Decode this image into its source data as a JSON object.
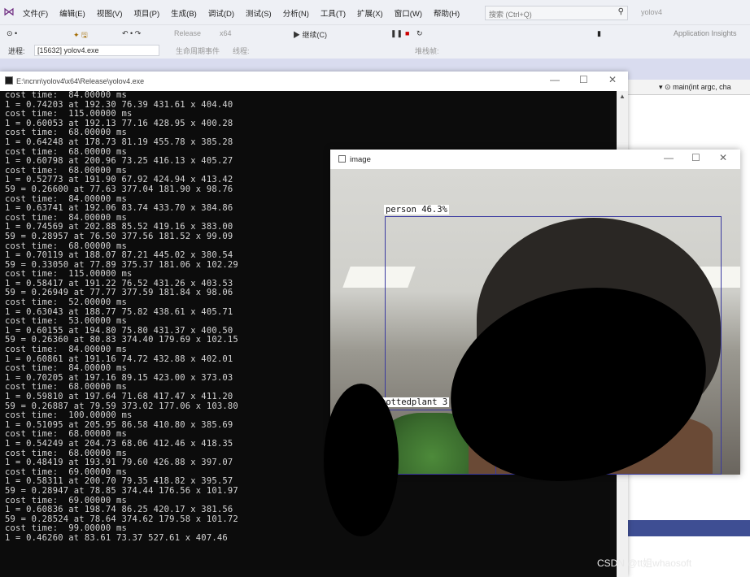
{
  "vs": {
    "menu": [
      "文件(F)",
      "编辑(E)",
      "视图(V)",
      "项目(P)",
      "生成(B)",
      "调试(D)",
      "测试(S)",
      "分析(N)",
      "工具(T)",
      "扩展(X)",
      "窗口(W)",
      "帮助(H)"
    ],
    "search_placeholder": "搜索 (Ctrl+Q)",
    "app_name": "yolov4",
    "toolbar_config": "Release",
    "toolbar_platform": "x64",
    "toolbar_continue": "继续(C)",
    "toolbar_app_insights": "Application Insights",
    "process_label": "进程:",
    "process_value": "[15632] yolov4.exe",
    "lifecycle_events": "生命周期事件",
    "thread_label": "线程:",
    "stack_label": "堆栈帧:",
    "main_signature": "main(int argc, cha"
  },
  "console": {
    "title": "E:\\ncnn\\yolov4\\x64\\Release\\yolov4.exe",
    "lines": [
      "cost time:  84.00000 ms",
      "1 = 0.74203 at 192.30 76.39 431.61 x 404.40",
      "cost time:  115.00000 ms",
      "1 = 0.60053 at 192.13 77.16 428.95 x 400.28",
      "cost time:  68.00000 ms",
      "1 = 0.64248 at 178.73 81.19 455.78 x 385.28",
      "cost time:  68.00000 ms",
      "1 = 0.60798 at 200.96 73.25 416.13 x 405.27",
      "cost time:  68.00000 ms",
      "1 = 0.52773 at 191.90 67.92 424.94 x 413.42",
      "59 = 0.26600 at 77.63 377.04 181.90 x 98.76",
      "cost time:  84.00000 ms",
      "1 = 0.63741 at 192.06 83.74 433.70 x 384.86",
      "cost time:  84.00000 ms",
      "1 = 0.74569 at 202.88 85.52 419.16 x 383.00",
      "59 = 0.28957 at 76.50 377.56 181.52 x 99.09",
      "cost time:  68.00000 ms",
      "1 = 0.70119 at 188.07 87.21 445.02 x 380.54",
      "59 = 0.33050 at 77.89 375.37 181.06 x 102.29",
      "cost time:  115.00000 ms",
      "1 = 0.58417 at 191.22 76.52 431.26 x 403.53",
      "59 = 0.26949 at 77.77 377.59 181.84 x 98.06",
      "cost time:  52.00000 ms",
      "1 = 0.63043 at 188.77 75.82 438.61 x 405.71",
      "cost time:  53.00000 ms",
      "1 = 0.60155 at 194.80 75.80 431.37 x 400.50",
      "59 = 0.26360 at 80.83 374.40 179.69 x 102.15",
      "cost time:  84.00000 ms",
      "1 = 0.60861 at 191.16 74.72 432.88 x 402.01",
      "cost time:  84.00000 ms",
      "1 = 0.70205 at 197.16 89.15 423.00 x 373.03",
      "cost time:  68.00000 ms",
      "1 = 0.59810 at 197.64 71.68 417.47 x 411.20",
      "59 = 0.26887 at 79.59 373.02 177.06 x 103.80",
      "cost time:  100.00000 ms",
      "1 = 0.51095 at 205.95 86.58 410.80 x 385.69",
      "cost time:  68.00000 ms",
      "1 = 0.54249 at 204.73 68.06 412.46 x 418.35",
      "cost time:  68.00000 ms",
      "1 = 0.48419 at 193.91 79.60 426.88 x 397.07",
      "cost time:  69.00000 ms",
      "1 = 0.58311 at 200.70 79.35 418.82 x 395.57",
      "59 = 0.28947 at 78.85 374.44 176.56 x 101.97",
      "cost time:  69.00000 ms",
      "1 = 0.60836 at 198.74 86.25 420.17 x 381.56",
      "59 = 0.28524 at 78.64 374.62 179.58 x 101.72",
      "cost time:  99.00000 ms",
      "1 = 0.46260 at 83.61 73.37 527.61 x 407.46"
    ]
  },
  "image_window": {
    "title": "image",
    "detections": [
      {
        "label": "person 46.3%"
      },
      {
        "label": "pottedplant 3"
      }
    ]
  },
  "watermark": "CSDN @tt姐whaosoft"
}
